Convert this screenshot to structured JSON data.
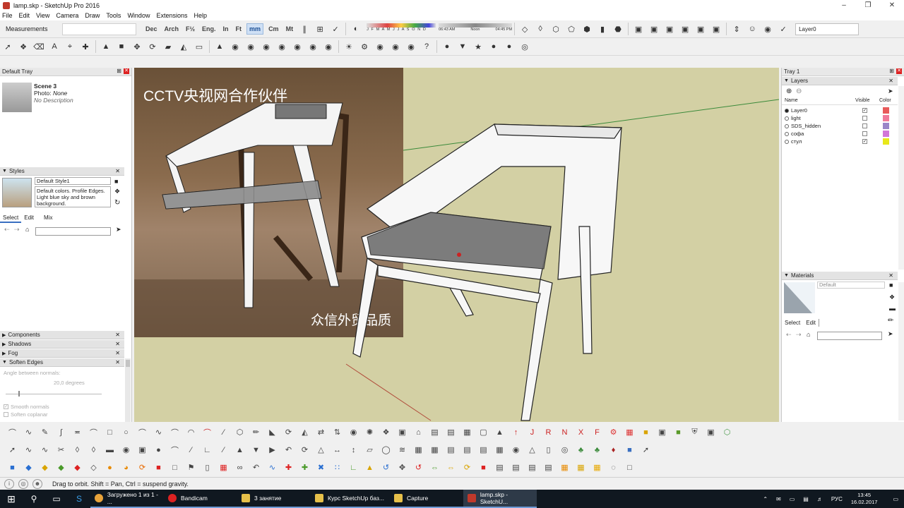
{
  "window": {
    "title": "lamp.skp - SketchUp Pro 2016"
  },
  "menu": [
    "File",
    "Edit",
    "View",
    "Camera",
    "Draw",
    "Tools",
    "Window",
    "Extensions",
    "Help"
  ],
  "toolbar": {
    "measurements_label": "Measurements",
    "units": [
      "Dec",
      "Arch",
      "F½",
      "Eng.",
      "In",
      "Ft",
      "mm",
      "Cm",
      "Mt"
    ],
    "active_unit": "mm",
    "shadow_months": "J F M A M J J A S O N D",
    "time_start": "06:43 AM",
    "time_noon": "Noon",
    "time_end": "04:45 PM",
    "current_layer": "Layer0"
  },
  "left_tray": {
    "title": "Default Tray",
    "scene": {
      "name": "Scene 3",
      "photo_label": "Photo:",
      "photo_value": "None",
      "description": "No Description"
    },
    "styles": {
      "header": "Styles",
      "style_name": "Default Style1",
      "style_description": "Default colors. Profile Edges. Light blue sky and brown background.",
      "tabs": [
        "Select",
        "Edit",
        "Mix"
      ]
    },
    "panels": [
      "Components",
      "Shadows",
      "Fog",
      "Soften Edges"
    ],
    "soften": {
      "angle_label": "Angle between normals:",
      "angle_value": "20,0  degrees",
      "smooth_normals": "Smooth normals",
      "soften_coplanar": "Soften coplanar"
    }
  },
  "viewport": {
    "watermark_top": "CCTV央视网合作伙伴",
    "watermark_bottom": "众信外贸品质"
  },
  "right_tray": {
    "title": "Tray 1",
    "layers_header": "Layers",
    "columns": {
      "name": "Name",
      "visible": "Visible",
      "color": "Color"
    },
    "layers": [
      {
        "name": "Layer0",
        "active": true,
        "visible": true,
        "color": "#e85a5a"
      },
      {
        "name": "light",
        "active": false,
        "visible": false,
        "color": "#f07a9a"
      },
      {
        "name": "SDS_hidden",
        "active": false,
        "visible": false,
        "color": "#9a86c8"
      },
      {
        "name": "софа",
        "active": false,
        "visible": false,
        "color": "#d276d8"
      },
      {
        "name": "стул",
        "active": false,
        "visible": true,
        "color": "#e8e81a"
      }
    ],
    "materials_header": "Materials",
    "material_name": "Default",
    "material_tabs": [
      "Select",
      "Edit"
    ]
  },
  "status": {
    "message": "Drag to orbit. Shift = Pan, Ctrl = suspend gravity."
  },
  "taskbar": {
    "tasks": [
      {
        "label": "Загружено 1 из 1 - ...",
        "color": "#e8a33a"
      },
      {
        "label": "Bandicam",
        "color": "#d22"
      },
      {
        "label": "3 занятие",
        "color": "#e6c04a"
      },
      {
        "label": "Курс SketchUp баз...",
        "color": "#e6c04a"
      },
      {
        "label": "Capture",
        "color": "#e6c04a"
      },
      {
        "label": "lamp.skp - SketchU...",
        "color": "#c0392b"
      }
    ],
    "lang": "РУС",
    "time": "13:45",
    "date": "16.02.2017"
  }
}
